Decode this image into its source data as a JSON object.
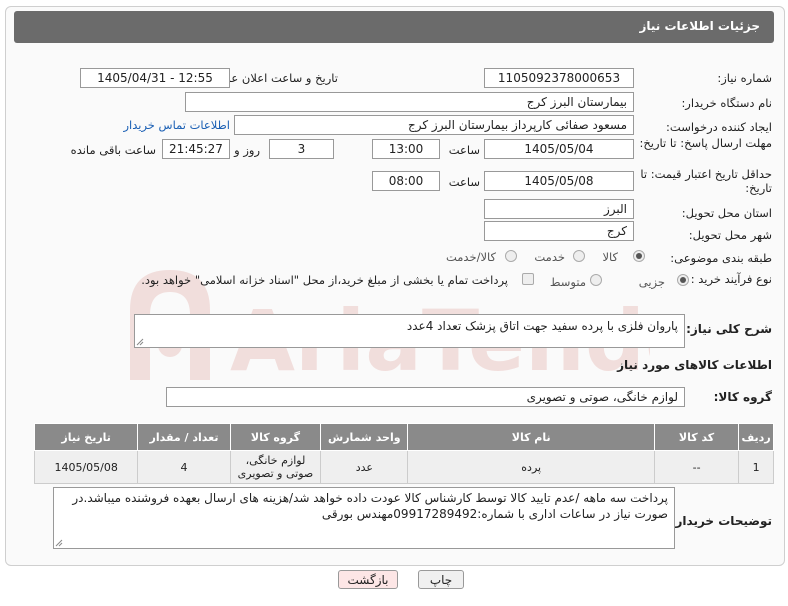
{
  "header": {
    "title": "جزئیات اطلاعات نیاز"
  },
  "form": {
    "need_number_label": "شماره نیاز:",
    "need_number": "1105092378000653",
    "announce_label": "تاریخ و ساعت اعلان عمومی:",
    "announce_value": "1405/04/31 - 12:55",
    "buyer_org_label": "نام دستگاه خریدار:",
    "buyer_org": "بیمارستان البرز کرج",
    "requester_label": "ایجاد کننده درخواست:",
    "requester": "مسعود صفائی کارپرداز بیمارستان البرز کرج",
    "contact_link": "اطلاعات تماس خریدار",
    "deadline_label": "مهلت ارسال پاسخ: تا تاریخ:",
    "deadline_date": "1405/05/04",
    "time_label": "ساعت",
    "deadline_time": "13:00",
    "days_value": "3",
    "days_label": "روز و",
    "remaining_time": "21:45:27",
    "remaining_label": "ساعت باقی مانده",
    "validity_label": "حداقل تاریخ اعتبار قیمت: تا تاریخ:",
    "validity_date": "1405/05/08",
    "validity_time": "08:00",
    "province_label": "استان محل تحویل:",
    "province": "البرز",
    "city_label": "شهر محل تحویل:",
    "city": "کرج",
    "category_label": "طبقه بندی موضوعی:",
    "category_options": [
      "کالا",
      "خدمت",
      "کالا/خدمت"
    ],
    "category_selected": "کالا",
    "process_label": "نوع فرآیند خرید :",
    "process_options": [
      "جزیی",
      "متوسط"
    ],
    "process_selected": "جزیی",
    "payment_note": "پرداخت تمام یا بخشی از مبلغ خرید،از محل \"اسناد خزانه اسلامی\" خواهد بود.",
    "general_desc_label": "شرح کلی نیاز:",
    "general_desc": "پاروان فلزی با پرده سفید جهت اتاق پزشک  تعداد 4عدد",
    "goods_info_title": "اطلاعات کالاهای مورد نیاز",
    "goods_group_label": "گروه کالا:",
    "goods_group": "لوازم خانگی، صوتی و تصویری"
  },
  "table": {
    "headers": [
      "ردیف",
      "کد کالا",
      "نام کالا",
      "واحد شمارش",
      "گروه کالا",
      "تعداد / مقدار",
      "تاریخ نیاز"
    ],
    "rows": [
      [
        "1",
        "--",
        "پرده",
        "عدد",
        "لوازم خانگی، صوتی و تصویری",
        "4",
        "1405/05/08"
      ]
    ]
  },
  "buyer_notes_label": "توضیحات خریدار:",
  "buyer_notes": "پرداخت سه ماهه /عدم تایید کالا توسط کارشناس کالا عودت داده خواهد شد/هزینه های ارسال بعهده فروشنده میباشد.در صورت نیاز در ساعات اداری با شماره:09917289492مهندس بورقی",
  "buttons": {
    "print": "چاپ",
    "back": "بازگشت"
  },
  "watermark": "AriaTender.net",
  "colors": {
    "header_bg": "#6b6b6b",
    "table_head_bg": "#8a8a8a",
    "link": "#1a5fb4",
    "back_btn_bg": "#fde6e6",
    "watermark": "#c0392b"
  }
}
